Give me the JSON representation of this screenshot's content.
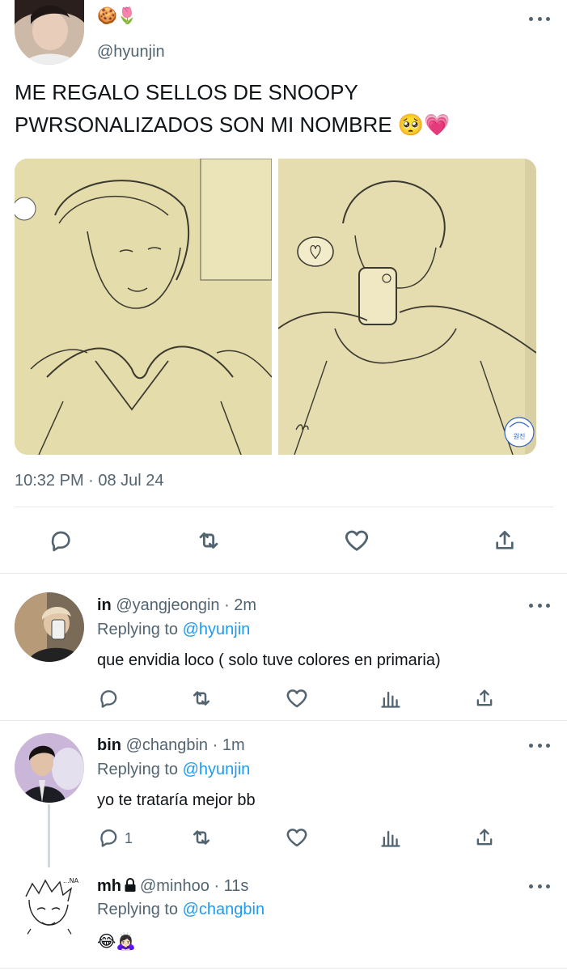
{
  "main_tweet": {
    "emojis": "🍪🌷",
    "handle": "@hyunjin",
    "text_line1": "ME REGALO SELLOS DE SNOOPY",
    "text_line2": "PWRSONALIZADOS SON MI NOMBRE 🥺💗",
    "timestamp": "10:32 PM · 08 Jul 24",
    "image_stamp": "원진"
  },
  "replies": [
    {
      "name": "in",
      "handle": "@yangjeongin · 2m",
      "replying_label": "Replying to",
      "replying_to": "@hyunjin",
      "text": "que envidia loco ( solo tuve colores en primaria)"
    },
    {
      "name": "bin",
      "handle": "@changbin · 1m",
      "replying_label": "Replying to",
      "replying_to": "@hyunjin",
      "text": "yo te trataría mejor bb",
      "reply_count": "1"
    },
    {
      "name": "mh",
      "handle": "@minhoo · 11s",
      "replying_label": "Replying to",
      "replying_to": "@changbin",
      "text": "😂🙇🏻‍♀️",
      "avatar_caption": "...NA"
    }
  ],
  "colors": {
    "link": "#1d9bf0",
    "muted": "#536471",
    "paper": "#e9e2b6"
  }
}
